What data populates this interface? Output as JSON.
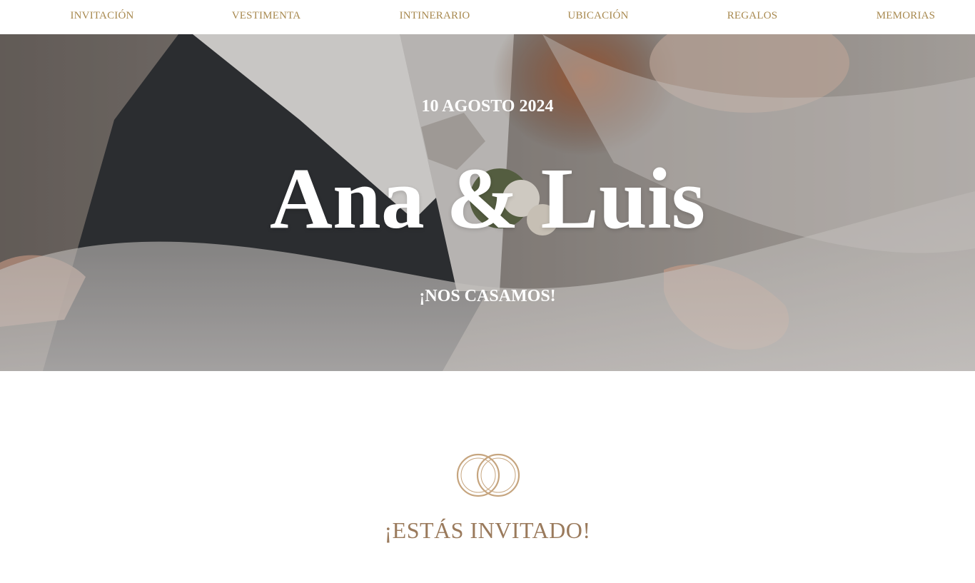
{
  "nav": {
    "items": [
      {
        "label": "INVITACIÓN"
      },
      {
        "label": "VESTIMENTA"
      },
      {
        "label": "INTINERARIO"
      },
      {
        "label": "UBICACIÓN"
      },
      {
        "label": "REGALOS"
      },
      {
        "label": "MEMORIAS"
      }
    ]
  },
  "hero": {
    "date": "10 AGOSTO 2024",
    "names": "Ana & Luis",
    "subtitle": "¡NOS CASAMOS!"
  },
  "invite": {
    "icon": "wedding-rings-icon",
    "title": "¡ESTÁS INVITADO!"
  },
  "colors": {
    "accent_gold": "#a8894f",
    "title_brown": "#9a7a5c",
    "hero_text": "#ffffff"
  }
}
